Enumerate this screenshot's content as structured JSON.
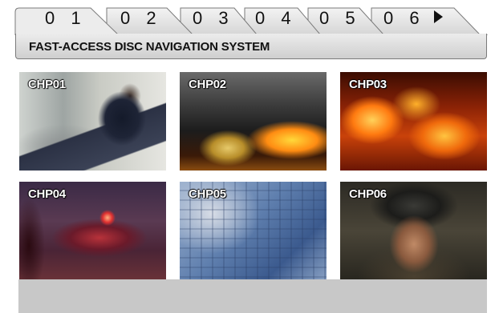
{
  "tabs": [
    {
      "label": "0 1"
    },
    {
      "label": "0 2"
    },
    {
      "label": "0 3"
    },
    {
      "label": "0 4"
    },
    {
      "label": "0 5"
    },
    {
      "label": "0 6"
    }
  ],
  "header": {
    "title": "FAST-ACCESS DISC NAVIGATION SYSTEM"
  },
  "chapters": [
    {
      "label": "CHP01",
      "image": "firefighter at dispatch console"
    },
    {
      "label": "CHP02",
      "image": "firefighters spraying burning structure"
    },
    {
      "label": "CHP03",
      "image": "wall of flames"
    },
    {
      "label": "CHP04",
      "image": "fire engine at night scene"
    },
    {
      "label": "CHP05",
      "image": "smoke-covered high-rise building"
    },
    {
      "label": "CHP06",
      "image": "firefighter portrait in helmet"
    }
  ],
  "colors": {
    "tab_fill": "#e4e4e4",
    "tab_border": "#7a7a7a",
    "title_bar": "#d8d8d8",
    "footer_bar": "#c8c8c8"
  },
  "icons": {
    "play": "play-icon"
  }
}
